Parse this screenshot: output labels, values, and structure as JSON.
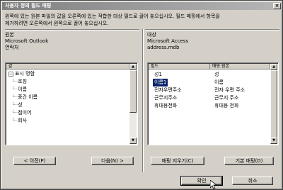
{
  "window": {
    "title": "사용자 정의 필드 매핑",
    "close_glyph": "×"
  },
  "instruction": {
    "line1": "왼쪽에 있는 원본 파일의 값을 오른쪽에 있는 적합한 대상 필드로 끌어 놓으십시오. 필드 매핑에서 항목을",
    "line2": "제거하려면 오른쪽에서 왼쪽으로 끌어 놓으십시오."
  },
  "source": {
    "section_label": "원본",
    "app": "Microsoft Outlook",
    "folder": "연락처",
    "column_header": "값",
    "tree": [
      {
        "label": "표시 명함",
        "kind": "parent",
        "sign": "⊟"
      },
      {
        "label": "호칭",
        "kind": "child"
      },
      {
        "label": "이름",
        "kind": "child"
      },
      {
        "label": "중간 이름",
        "kind": "child"
      },
      {
        "label": "성",
        "kind": "child"
      },
      {
        "label": "접미어",
        "kind": "child"
      },
      {
        "label": "회사",
        "kind": "child"
      }
    ],
    "prev_button": "< 이전(P)",
    "next_button": "다음(N) >"
  },
  "target": {
    "section_label": "대상",
    "app": "Microsoft Access",
    "file": "address.mdb",
    "column_headers": [
      "필드",
      "매핑 원본"
    ],
    "rows": [
      {
        "field": "성1",
        "mapped": "성"
      },
      {
        "field": "이름1",
        "mapped": "이름"
      },
      {
        "field": "전자우편주소",
        "mapped": "전자 우편 주소"
      },
      {
        "field": "근무지주소",
        "mapped": "근무지 주소"
      },
      {
        "field": "휴대용전화",
        "mapped": "휴대용 전화"
      }
    ],
    "selected_index": 1,
    "clear_button": "매핑 지우기(C)",
    "default_button": "기본 매핑(D)"
  },
  "footer": {
    "ok_button": "확인",
    "cancel_button": "취소"
  },
  "colors": {
    "face": "#d4d0c8",
    "selection": "#0a246a"
  }
}
